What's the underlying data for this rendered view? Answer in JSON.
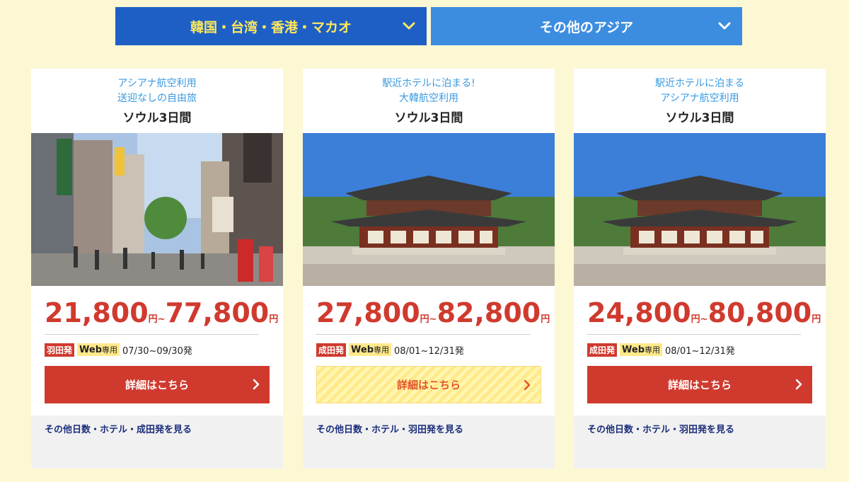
{
  "tabs": [
    {
      "label": "韓国・台湾・香港・マカオ",
      "icon": "chevron-down-icon",
      "active": true
    },
    {
      "label": "その他のアジア",
      "icon": "chevron-down-icon",
      "active": false
    }
  ],
  "colors": {
    "background": "#fdf8d4",
    "tab_active": "#1e5fc6",
    "tab_inactive": "#3c8de0",
    "price": "#d03a2e",
    "link": "#1a2d7a",
    "subtitle": "#3a9ae0"
  },
  "cards": [
    {
      "subtitle_line1": "アシアナ航空利用",
      "subtitle_line2": "送迎なしの自由旅",
      "title": "ソウル3日間",
      "price_from": "21,800",
      "price_to": "77,800",
      "unit": "円",
      "tilde": "~",
      "departure": "羽田発",
      "web": "Web",
      "web_only": "専用",
      "period": "07/30~09/30発",
      "button": "詳細はこちら",
      "button_style": "red",
      "more_link": "その他日数・ホテル・成田発を見る",
      "image": "street-photo"
    },
    {
      "subtitle_line1": "駅近ホテルに泊まる!",
      "subtitle_line2": "大韓航空利用",
      "title": "ソウル3日間",
      "price_from": "27,800",
      "price_to": "82,800",
      "unit": "円",
      "tilde": "~",
      "departure": "成田発",
      "web": "Web",
      "web_only": "専用",
      "period": "08/01~12/31発",
      "button": "詳細はこちら",
      "button_style": "yellow",
      "more_link": "その他日数・ホテル・羽田発を見る",
      "image": "palace-photo"
    },
    {
      "subtitle_line1": "駅近ホテルに泊まる",
      "subtitle_line2": "アシアナ航空利用",
      "title": "ソウル3日間",
      "price_from": "24,800",
      "price_to": "80,800",
      "unit": "円",
      "tilde": "~",
      "departure": "成田発",
      "web": "Web",
      "web_only": "専用",
      "period": "08/01~12/31発",
      "button": "詳細はこちら",
      "button_style": "red",
      "more_link": "その他日数・ホテル・羽田発を見る",
      "image": "palace-photo"
    }
  ]
}
